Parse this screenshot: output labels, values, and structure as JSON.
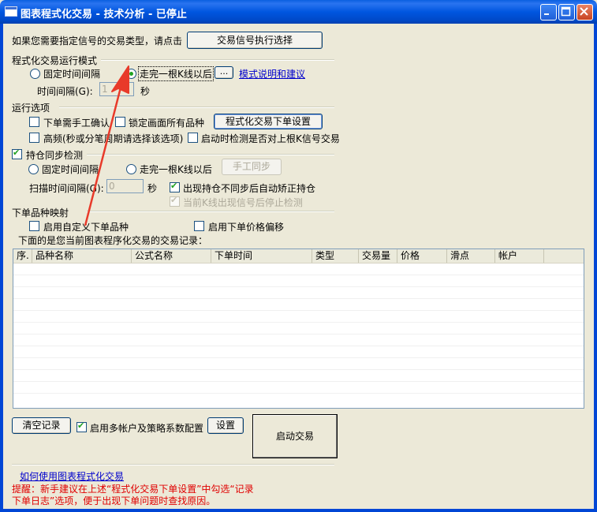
{
  "window": {
    "title": "图表程式化交易 - 技术分析 - 已停止"
  },
  "signal_prompt": {
    "text": "如果您需要指定信号的交易类型，请点击",
    "button": "交易信号执行选择"
  },
  "run_mode": {
    "heading": "程式化交易运行模式",
    "fixed_interval_label": "固定时间间隔",
    "bar_complete_label": "走完一根K线以后",
    "more_button": "...",
    "mode_help_link": "模式说明和建议",
    "interval_label": "时间间隔(G):",
    "interval_value": "1",
    "interval_unit": "秒"
  },
  "run_options": {
    "heading": "运行选项",
    "manual_confirm_label": "下单需手工确认",
    "lock_all_label": "锁定画面所有品种",
    "order_settings_button": "程式化交易下单设置",
    "high_freq_label": "高频(秒或分笔周期请选择该选项)",
    "check_last_bar_label": "启动时检测是否对上根K信号交易"
  },
  "position_sync": {
    "heading": "持仓同步检测",
    "fixed_interval_label": "固定时间间隔",
    "bar_complete_label": "走完一根K线以后",
    "manual_sync_button": "手工同步",
    "scan_interval_label": "扫描时间间隔(G):",
    "scan_interval_value": "0",
    "scan_interval_unit": "秒",
    "auto_correct_label": "出现持仓不同步后自动矫正持仓",
    "stop_detect_label": "当前K线出现信号后停止检测"
  },
  "order_mapping": {
    "heading": "下单品种映射",
    "custom_symbol_label": "启用自定义下单品种",
    "price_offset_label": "启用下单价格偏移"
  },
  "records": {
    "caption": "下面的是您当前图表程序化交易的交易记录：",
    "columns": [
      "序.",
      "品种名称",
      "公式名称",
      "下单时间",
      "类型",
      "交易量",
      "价格",
      "滑点",
      "帐户"
    ]
  },
  "bottom": {
    "clear_button": "清空记录",
    "multi_account_label": "启用多帐户及策略系数配置",
    "settings_button": "设置",
    "start_button": "启动交易",
    "howto_link": "如何使用图表程式化交易",
    "hint_line1": "提醒：新手建议在上述“程式化交易下单设置”中勾选“记录",
    "hint_line2": "下单日志”选项，便于出现下单问题时查找原因。"
  },
  "colors": {
    "titlebar": "#0054e3",
    "annotation_arrow": "#e83a2a",
    "hint_text": "#e00000",
    "link": "#0000cc"
  }
}
